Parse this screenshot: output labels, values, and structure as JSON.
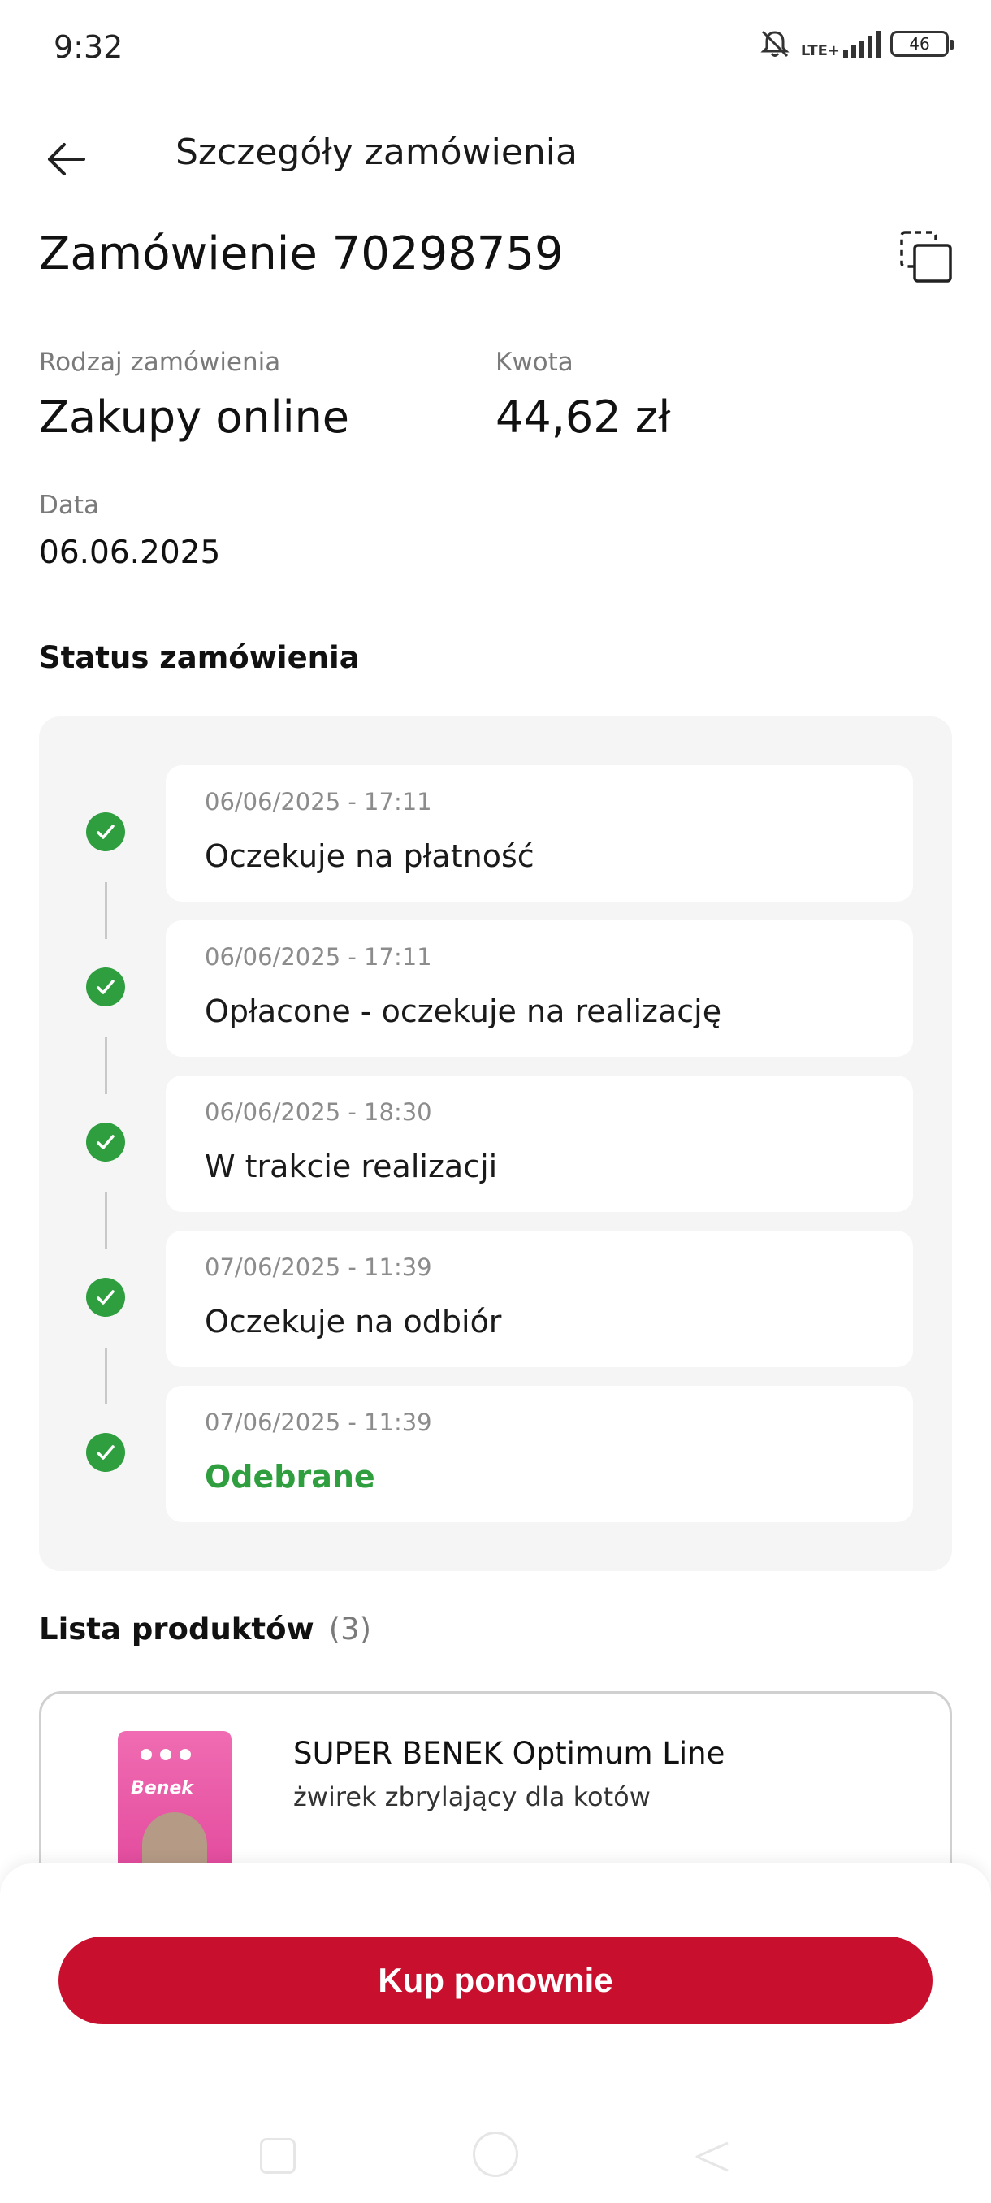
{
  "status_bar": {
    "time": "9:32",
    "network": "LTE+",
    "battery": "46"
  },
  "header": {
    "title": "Szczegóły zamówienia"
  },
  "order": {
    "title": "Zamówienie 70298759",
    "type_label": "Rodzaj zamówienia",
    "type_value": "Zakupy online",
    "amount_label": "Kwota",
    "amount_value": "44,62 zł",
    "date_label": "Data",
    "date_value": "06.06.2025"
  },
  "status_section": {
    "title": "Status zamówienia",
    "steps": [
      {
        "date": "06/06/2025 - 17:11",
        "label": "Oczekuje na płatność"
      },
      {
        "date": "06/06/2025 - 17:11",
        "label": "Opłacone - oczekuje na realizację"
      },
      {
        "date": "06/06/2025 - 18:30",
        "label": "W trakcie realizacji"
      },
      {
        "date": "07/06/2025 - 11:39",
        "label": "Oczekuje na odbiór"
      },
      {
        "date": "07/06/2025 - 11:39",
        "label": "Odebrane"
      }
    ]
  },
  "products": {
    "title": "Lista produktów",
    "count": "(3)",
    "items": [
      {
        "name": "SUPER BENEK Optimum Line",
        "description": "żwirek zbrylający dla kotów",
        "image_brand_text": "Benek"
      }
    ]
  },
  "footer": {
    "buy_again_label": "Kup ponownie"
  },
  "colors": {
    "accent": "#c8102e",
    "success": "#2e9e3f",
    "timeline_bg": "#f5f5f5"
  }
}
